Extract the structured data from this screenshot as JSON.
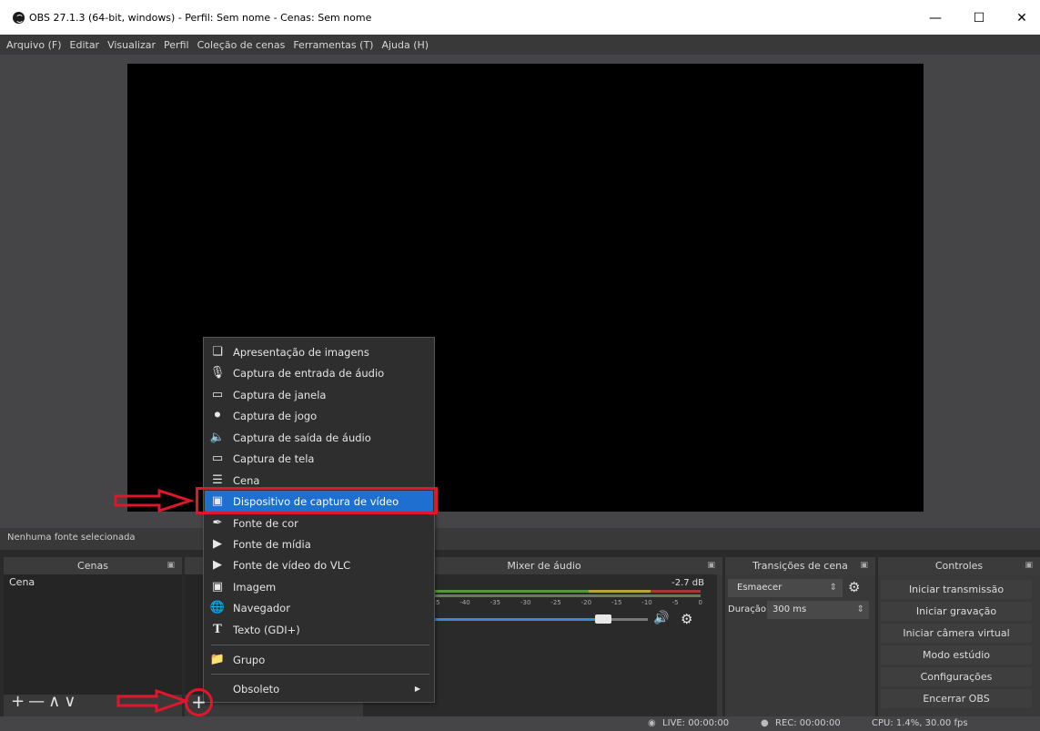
{
  "window": {
    "title": "OBS 27.1.3 (64-bit, windows) - Perfil: Sem nome - Cenas: Sem nome"
  },
  "menubar": [
    "Arquivo (F)",
    "Editar",
    "Visualizar",
    "Perfil",
    "Coleção de cenas",
    "Ferramentas (T)",
    "Ajuda (H)"
  ],
  "sources_status": "Nenhuma fonte selecionada",
  "scenes": {
    "header": "Cenas",
    "items": [
      "Cena"
    ]
  },
  "mixer": {
    "header": "Mixer de áudio",
    "level": "-2.7 dB",
    "ticks": [
      "-45",
      "-40",
      "-35",
      "-30",
      "-25",
      "-20",
      "-15",
      "-10",
      "-5",
      "0"
    ]
  },
  "transitions": {
    "header": "Transições de cena",
    "selected": "Esmaecer",
    "duration_label": "Duração",
    "duration_value": "300 ms"
  },
  "controls": {
    "header": "Controles",
    "buttons": [
      "Iniciar transmissão",
      "Iniciar gravação",
      "Iniciar câmera virtual",
      "Modo estúdio",
      "Configurações",
      "Encerrar OBS"
    ]
  },
  "context_menu": {
    "items": [
      "Apresentação de imagens",
      "Captura de entrada de áudio",
      "Captura de janela",
      "Captura de jogo",
      "Captura de saída de áudio",
      "Captura de tela",
      "Cena",
      "Dispositivo de captura de vídeo",
      "Fonte de cor",
      "Fonte de mídia",
      "Fonte de vídeo do VLC",
      "Imagem",
      "Navegador",
      "Texto (GDI+)"
    ],
    "grupo": "Grupo",
    "obsoleto": "Obsoleto",
    "selected_index": 7
  },
  "statusbar": {
    "live": "LIVE: 00:00:00",
    "rec": "REC: 00:00:00",
    "cpu": "CPU: 1.4%, 30.00 fps"
  },
  "colors": {
    "accent": "#1e6fcf",
    "annotation": "#e0162b"
  }
}
